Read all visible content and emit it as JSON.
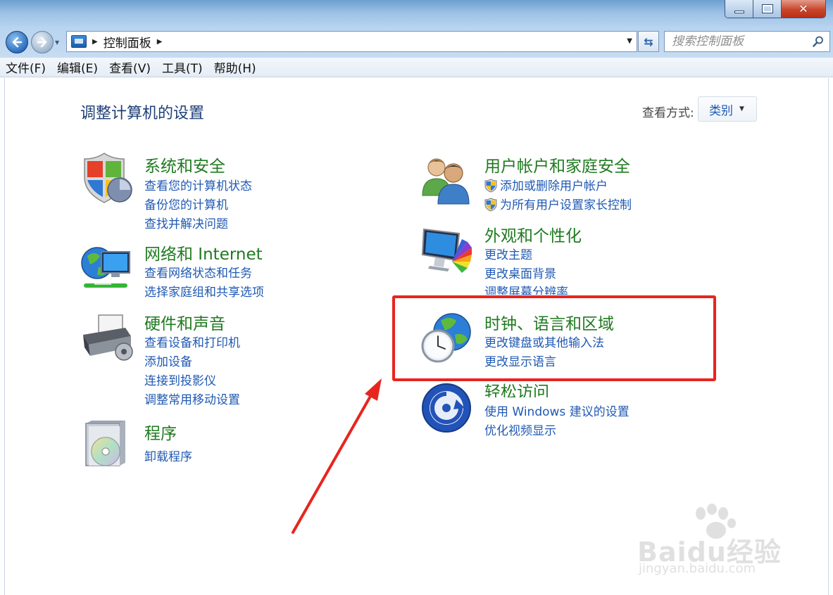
{
  "window": {
    "buttons": [
      "minimize",
      "maximize",
      "close"
    ]
  },
  "address": {
    "path": "控制面板",
    "search_placeholder": "搜索控制面板"
  },
  "menubar": {
    "items": [
      "文件(F)",
      "编辑(E)",
      "查看(V)",
      "工具(T)",
      "帮助(H)"
    ]
  },
  "main": {
    "title": "调整计算机的设置",
    "view_by_label": "查看方式:",
    "view_by_value": "类别"
  },
  "left_categories": [
    {
      "title": "系统和安全",
      "icon": "shield-security-icon",
      "links": [
        "查看您的计算机状态",
        "备份您的计算机",
        "查找并解决问题"
      ]
    },
    {
      "title": "网络和 Internet",
      "icon": "network-globe-icon",
      "links": [
        "查看网络状态和任务",
        "选择家庭组和共享选项"
      ]
    },
    {
      "title": "硬件和声音",
      "icon": "printer-icon",
      "links": [
        "查看设备和打印机",
        "添加设备",
        "连接到投影仪",
        "调整常用移动设置"
      ]
    },
    {
      "title": "程序",
      "icon": "programs-disc-icon",
      "links": [
        "卸载程序"
      ]
    }
  ],
  "right_categories": [
    {
      "title": "用户帐户和家庭安全",
      "icon": "users-icon",
      "links": [
        "添加或删除用户帐户",
        "为所有用户设置家长控制"
      ]
    },
    {
      "title": "外观和个性化",
      "icon": "monitor-palette-icon",
      "links": [
        "更改主题",
        "更改桌面背景",
        "调整屏幕分辨率"
      ]
    },
    {
      "title": "时钟、语言和区域",
      "icon": "clock-globe-icon",
      "links": [
        "更改键盘或其他输入法",
        "更改显示语言"
      ]
    },
    {
      "title": "轻松访问",
      "icon": "ease-of-access-icon",
      "links": [
        "使用 Windows 建议的设置",
        "优化视频显示"
      ]
    }
  ],
  "annotation": {
    "highlight_color": "#e8251d"
  },
  "watermark": {
    "main": "Baidu经验",
    "sub": "jingyan.baidu.com"
  }
}
